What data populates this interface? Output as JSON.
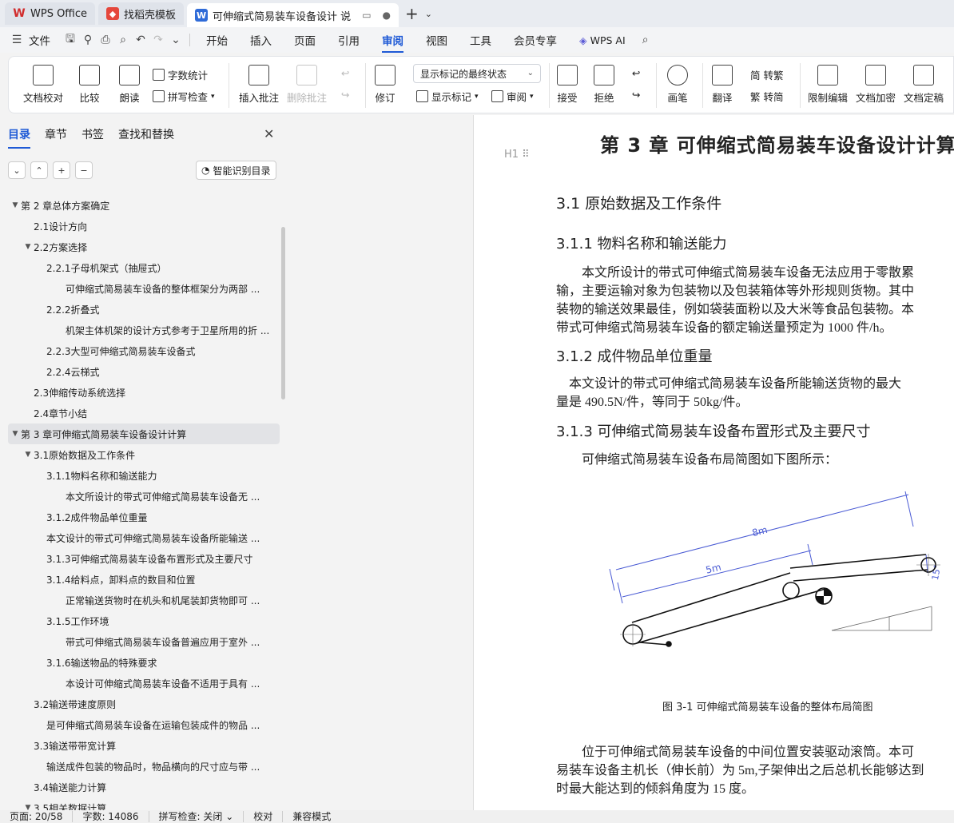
{
  "tabs": [
    {
      "label": "WPS Office"
    },
    {
      "label": "找稻壳模板"
    },
    {
      "label": "可伸缩式简易装车设备设计 说"
    }
  ],
  "menu": {
    "file": "文件",
    "items": [
      "开始",
      "插入",
      "页面",
      "引用",
      "审阅",
      "视图",
      "工具",
      "会员专享"
    ],
    "active": "审阅",
    "ai": "WPS AI"
  },
  "ribbon": {
    "doc_check": "文档校对",
    "compare": "比较",
    "read": "朗读",
    "word_count": "字数统计",
    "spell_check": "拼写检查",
    "insert_comment": "插入批注",
    "delete_comment": "删除批注",
    "revise": "修订",
    "display_mode": "显示标记的最终状态",
    "show_marks": "显示标记",
    "review": "审阅",
    "accept": "接受",
    "reject": "拒绝",
    "pen": "画笔",
    "translate": "翻译",
    "to_traditional": "简 转繁",
    "to_simplified": "繁 转简",
    "restrict_edit": "限制编辑",
    "encrypt": "文档加密",
    "finalize": "文档定稿"
  },
  "pane": {
    "tabs": [
      "目录",
      "章节",
      "书签",
      "查找和替换"
    ],
    "smart_toc": "智能识别目录",
    "toc": [
      {
        "level": 0,
        "text": "第 2 章总体方案确定",
        "arrow": "▼"
      },
      {
        "level": 1,
        "text": "2.1设计方向"
      },
      {
        "level": 1,
        "text": "2.2方案选择",
        "arrow": "▼"
      },
      {
        "level": 2,
        "text": "2.2.1子母机架式（抽屉式）"
      },
      {
        "level": 3,
        "text": "可伸缩式简易装车设备的整体框架分为两部 ..."
      },
      {
        "level": 2,
        "text": "2.2.2折叠式"
      },
      {
        "level": 3,
        "text": "机架主体机架的设计方式参考于卫星所用的折 ..."
      },
      {
        "level": 2,
        "text": "2.2.3大型可伸缩式简易装车设备式"
      },
      {
        "level": 2,
        "text": "2.2.4云梯式"
      },
      {
        "level": 1,
        "text": "2.3伸缩传动系统选择"
      },
      {
        "level": 1,
        "text": "2.4章节小结"
      },
      {
        "level": 0,
        "text": "第 3 章可伸缩式简易装车设备设计计算",
        "arrow": "▼",
        "selected": true
      },
      {
        "level": 1,
        "text": "3.1原始数据及工作条件",
        "arrow": "▼"
      },
      {
        "level": 2,
        "text": "3.1.1物料名称和输送能力"
      },
      {
        "level": 3,
        "text": "本文所设计的带式可伸缩式简易装车设备无 ..."
      },
      {
        "level": 2,
        "text": "3.1.2成件物品单位重量"
      },
      {
        "level": 2,
        "text": "本文设计的带式可伸缩式简易装车设备所能输送 ..."
      },
      {
        "level": 2,
        "text": "3.1.3可伸缩式简易装车设备布置形式及主要尺寸"
      },
      {
        "level": 2,
        "text": "3.1.4给料点，卸料点的数目和位置"
      },
      {
        "level": 3,
        "text": "正常输送货物时在机头和机尾装卸货物即可 ..."
      },
      {
        "level": 2,
        "text": "3.1.5工作环境"
      },
      {
        "level": 3,
        "text": "带式可伸缩式简易装车设备普遍应用于室外 ..."
      },
      {
        "level": 2,
        "text": "3.1.6输送物品的特殊要求"
      },
      {
        "level": 3,
        "text": "本设计可伸缩式简易装车设备不适用于具有 ..."
      },
      {
        "level": 1,
        "text": "3.2输送带速度原则"
      },
      {
        "level": 2,
        "text": "是可伸缩式简易装车设备在运输包装成件的物品 ..."
      },
      {
        "level": 1,
        "text": "3.3输送带带宽计算"
      },
      {
        "level": 2,
        "text": "输送成件包装的物品时，物品横向的尺寸应与带 ..."
      },
      {
        "level": 1,
        "text": "3.4输送能力计算"
      },
      {
        "level": 1,
        "text": "3.5相关数据计算",
        "arrow": "▼"
      }
    ]
  },
  "doc": {
    "chapter_title": "第 3 章  可伸缩式简易装车设备设计计算",
    "heading_mark": "H1",
    "h_3_1": "3.1  原始数据及工作条件",
    "h_3_1_1": "3.1.1  物料名称和输送能力",
    "p1": [
      "　　本文所设计的带式可伸缩式简易装车设备无法应用于零散累",
      "输，主要运输对象为包装物以及包装箱体等外形规则货物。其中",
      "装物的输送效果最佳，例如袋装面粉以及大米等食品包装物。本",
      "带式可伸缩式简易装车设备的额定输送量预定为 1000 件/h。"
    ],
    "h_3_1_2": "3.1.2  成件物品单位重量",
    "p2": [
      "　本文设计的带式可伸缩式简易装车设备所能输送货物的最大",
      "量是 490.5N/件，等同于 50kg/件。"
    ],
    "h_3_1_3": "3.1.3  可伸缩式简易装车设备布置形式及主要尺寸",
    "p3": "　　可伸缩式简易装车设备布局简图如下图所示：",
    "dim_8m": "8m",
    "dim_5m": "5m",
    "dim_angle": "15°",
    "caption": "图 3-1 可伸缩式简易装车设备的整体布局简图",
    "p4": [
      "　　位于可伸缩式简易装车设备的中间位置安装驱动滚筒。本可",
      "易装车设备主机长（伸长前）为 5m,子架伸出之后总机长能够达到",
      "时最大能达到的倾斜角度为 15 度。"
    ]
  },
  "status": {
    "page": "页面: 20/58",
    "words": "字数: 14086",
    "spell": "拼写检查: 关闭",
    "proof": "校对",
    "compat": "兼容模式"
  }
}
